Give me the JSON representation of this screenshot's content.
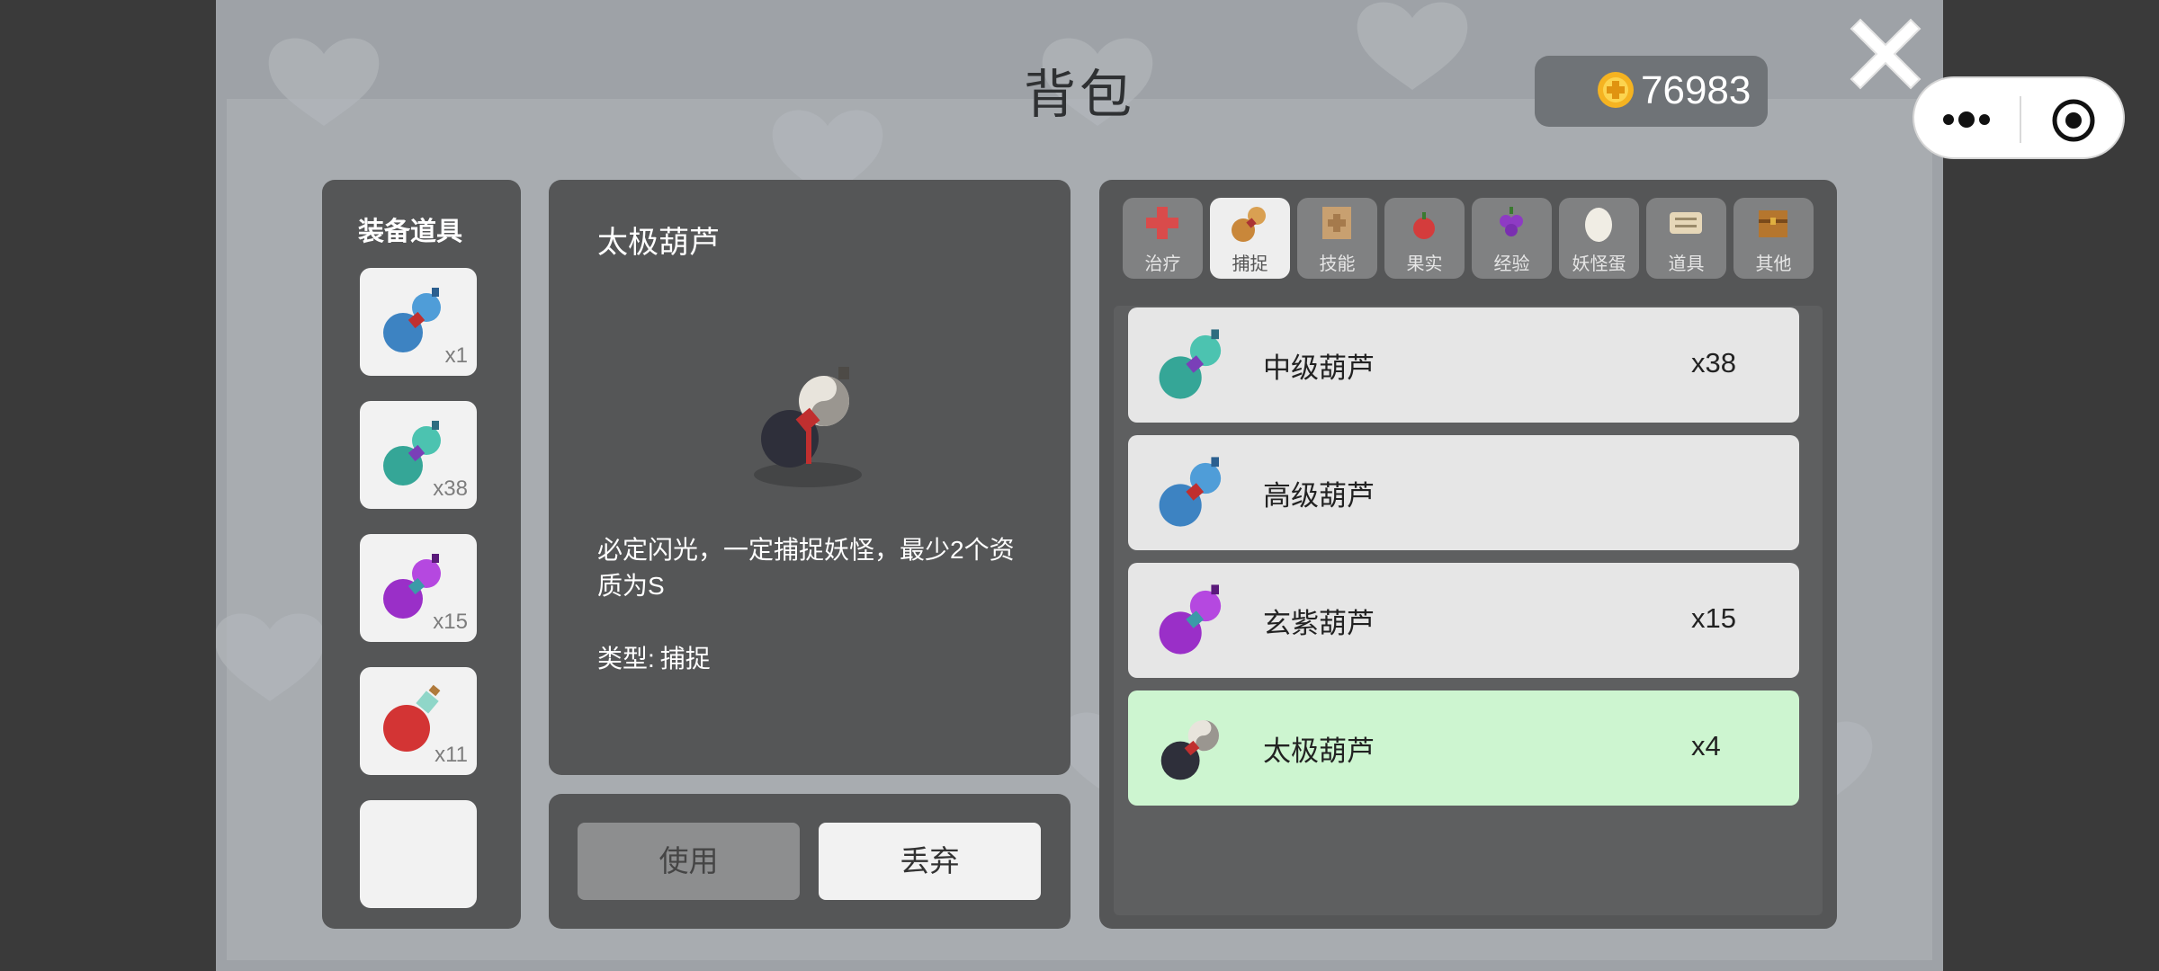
{
  "title": "背包",
  "coins": "76983",
  "equip": {
    "title": "装备道具",
    "slots": [
      {
        "icon": "blue-gourd-icon",
        "count": "x1"
      },
      {
        "icon": "teal-gourd-icon",
        "count": "x38"
      },
      {
        "icon": "purple-gourd-icon",
        "count": "x15"
      },
      {
        "icon": "red-potion-icon",
        "count": "x11"
      },
      {
        "icon": "",
        "count": ""
      }
    ]
  },
  "detail": {
    "name": "太极葫芦",
    "icon": "taiji-gourd-icon",
    "description": "必定闪光，一定捕捉妖怪，最少2个资质为S",
    "type_label": "类型:",
    "type_value": "捕捉"
  },
  "actions": {
    "use": "使用",
    "discard": "丢弃"
  },
  "tabs": [
    {
      "label": "治疗",
      "icon": "red-cross-icon",
      "active": false
    },
    {
      "label": "捕捉",
      "icon": "gourd-icon",
      "active": true
    },
    {
      "label": "技能",
      "icon": "scroll-icon",
      "active": false
    },
    {
      "label": "果实",
      "icon": "berry-icon",
      "active": false
    },
    {
      "label": "经验",
      "icon": "grape-icon",
      "active": false
    },
    {
      "label": "妖怪蛋",
      "icon": "egg-icon",
      "active": false
    },
    {
      "label": "道具",
      "icon": "paper-icon",
      "active": false
    },
    {
      "label": "其他",
      "icon": "chest-icon",
      "active": false
    }
  ],
  "items": [
    {
      "name": "中级葫芦",
      "count": "x38",
      "icon": "teal-gourd-icon",
      "selected": false
    },
    {
      "name": "高级葫芦",
      "count": "",
      "icon": "blue-gourd-icon",
      "selected": false
    },
    {
      "name": "玄紫葫芦",
      "count": "x15",
      "icon": "purple-gourd-icon",
      "selected": false
    },
    {
      "name": "太极葫芦",
      "count": "x4",
      "icon": "taiji-gourd-icon",
      "selected": true
    }
  ],
  "colors": {
    "panel": "#555657",
    "selected_row": "#cdf5d0",
    "active_tab": "#eeeeee",
    "background": "#9ea2a7"
  }
}
